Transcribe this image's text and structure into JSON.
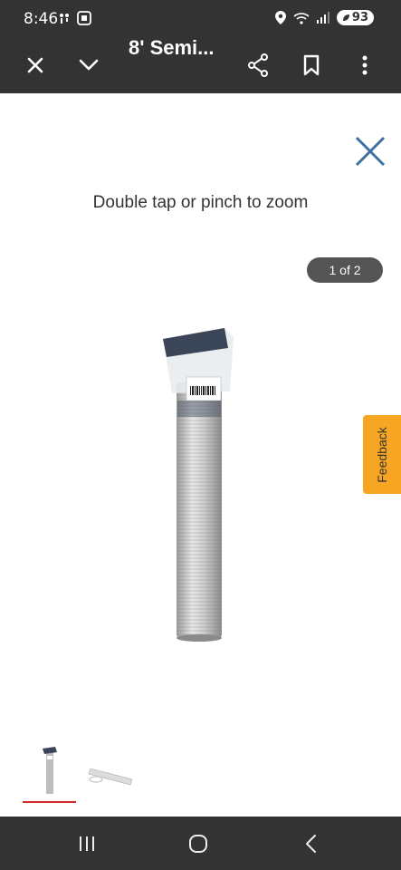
{
  "status_bar": {
    "time": "8:46",
    "battery": "93"
  },
  "app_bar": {
    "title": "8' Semi...",
    "close_icon": "close-icon",
    "collapse_icon": "chevron-down-icon",
    "share_icon": "share-icon",
    "bookmark_icon": "bookmark-icon",
    "more_icon": "more-vertical-icon"
  },
  "viewer": {
    "zoom_hint": "Double tap or pinch to zoom",
    "page_counter": "1 of 2",
    "close_icon": "close-icon",
    "accent_color": "#3e6fa3"
  },
  "feedback": {
    "label": "Feedback",
    "color": "#f6a623"
  },
  "thumbnails": {
    "selected_index": 0,
    "selected_color": "#d62a2a"
  },
  "nav_bar": {
    "recents_icon": "recents-icon",
    "home_icon": "home-icon",
    "back_icon": "back-icon"
  }
}
